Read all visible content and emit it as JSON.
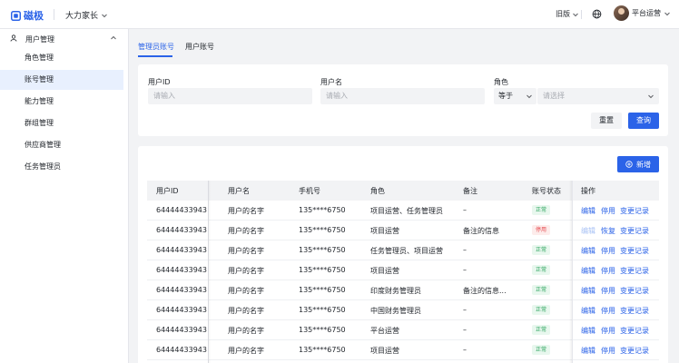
{
  "app": {
    "logo_text": "磁极",
    "org_name": "大力家长",
    "old_version": "旧版",
    "user_name": "平台运营"
  },
  "sidebar": {
    "group_label": "用户管理",
    "items": [
      {
        "label": "角色管理",
        "active": false
      },
      {
        "label": "账号管理",
        "active": true
      },
      {
        "label": "能力管理",
        "active": false
      },
      {
        "label": "群组管理",
        "active": false
      },
      {
        "label": "供应商管理",
        "active": false
      },
      {
        "label": "任务管理员",
        "active": false
      }
    ]
  },
  "tabs": [
    {
      "label": "管理员账号",
      "active": true
    },
    {
      "label": "用户账号",
      "active": false
    }
  ],
  "filter": {
    "user_id_label": "用户ID",
    "user_id_placeholder": "请输入",
    "user_name_label": "用户名",
    "user_name_placeholder": "请输入",
    "role_label": "角色",
    "role_operator": "等于",
    "role_placeholder": "请选择",
    "reset_label": "重置",
    "query_label": "查询"
  },
  "table": {
    "add_label": "新增",
    "columns": [
      "用户ID",
      "用户名",
      "手机号",
      "角色",
      "备注",
      "账号状态",
      "操作"
    ],
    "actions": {
      "edit": "编辑",
      "disable": "停用",
      "enable": "恢复",
      "history": "变更记录"
    },
    "rows": [
      {
        "id": "64444433943",
        "name": "用户的名字",
        "phone": "135****6750",
        "role": "项目运营、任务管理员",
        "note": "–",
        "status": "正常",
        "status_ok": true
      },
      {
        "id": "64444433943",
        "name": "用户的名字",
        "phone": "135****6750",
        "role": "项目运营",
        "note": "备注的信息",
        "status": "停用",
        "status_ok": false
      },
      {
        "id": "64444433943",
        "name": "用户的名字",
        "phone": "135****6750",
        "role": "任务管理员、项目运营",
        "note": "–",
        "status": "正常",
        "status_ok": true
      },
      {
        "id": "64444433943",
        "name": "用户的名字",
        "phone": "135****6750",
        "role": "项目运营",
        "note": "–",
        "status": "正常",
        "status_ok": true
      },
      {
        "id": "64444433943",
        "name": "用户的名字",
        "phone": "135****6750",
        "role": "印度财务管理员",
        "note": "备注的信息...",
        "status": "正常",
        "status_ok": true
      },
      {
        "id": "64444433943",
        "name": "用户的名字",
        "phone": "135****6750",
        "role": "中国财务管理员",
        "note": "–",
        "status": "正常",
        "status_ok": true
      },
      {
        "id": "64444433943",
        "name": "用户的名字",
        "phone": "135****6750",
        "role": "平台运营",
        "note": "–",
        "status": "正常",
        "status_ok": true
      },
      {
        "id": "64444433943",
        "name": "用户的名字",
        "phone": "135****6750",
        "role": "项目运营",
        "note": "–",
        "status": "正常",
        "status_ok": true
      }
    ]
  },
  "colors": {
    "accent": "#2b63e8",
    "ok": "#2ba45c",
    "danger": "#e5484d"
  }
}
